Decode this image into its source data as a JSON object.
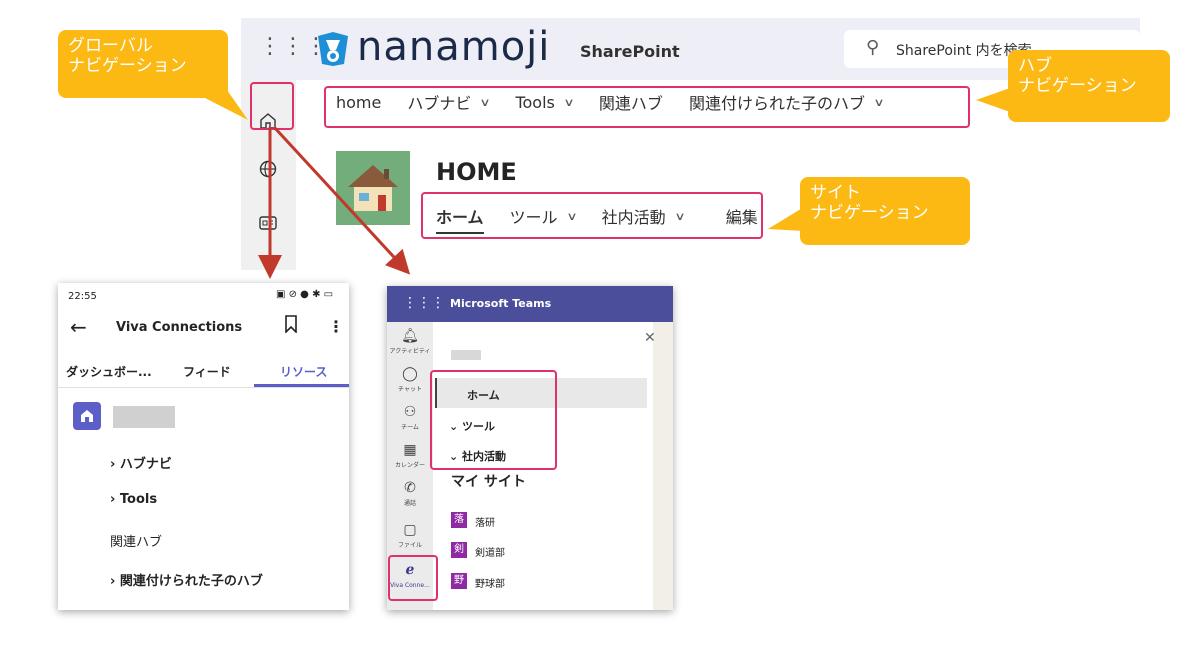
{
  "sharepoint": {
    "waffle": "⋮⋮⋮",
    "logo_text": "nanamoji",
    "product": "SharePoint",
    "search_placeholder": "SharePoint 内を検索",
    "hub_nav": [
      "home",
      "ハブナビ",
      "Tools",
      "関連ハブ",
      "関連付けられた子のハブ"
    ],
    "hub_nav_has_chevron": [
      false,
      true,
      true,
      false,
      true
    ],
    "site_title": "HOME",
    "site_nav": [
      "ホーム",
      "ツール",
      "社内活動",
      "編集"
    ],
    "site_nav_has_chevron": [
      false,
      true,
      true,
      false
    ]
  },
  "callouts": {
    "global": "グローバル\nナビゲーション",
    "hub": "ハブ\nナビゲーション",
    "site": "サイト\nナビゲーション"
  },
  "phone": {
    "time": "22:55",
    "title": "Viva Connections",
    "tabs": [
      "ダッシュボー...",
      "フィード",
      "リソース"
    ],
    "active_tab": "リソース",
    "items": [
      "ハブナビ",
      "Tools",
      "関連ハブ",
      "関連付けられた子のハブ"
    ],
    "items_have_chevron": [
      true,
      true,
      false,
      true
    ]
  },
  "teams": {
    "app_name": "Microsoft Teams",
    "rail": [
      "アクティビティ",
      "チャット",
      "チーム",
      "カレンダー",
      "通話",
      "ファイル",
      "Viva Conne..."
    ],
    "nav_items": [
      "ホーム",
      "ツール",
      "社内活動"
    ],
    "my_sites_heading": "マイ サイト",
    "sites": [
      {
        "badge": "落",
        "name": "落研"
      },
      {
        "badge": "剣",
        "name": "剣道部"
      },
      {
        "badge": "野",
        "name": "野球部"
      }
    ]
  },
  "colors": {
    "accent": "#5b5fc7",
    "callout": "#fcb913",
    "highlight": "#e0316e",
    "arrow": "#c0392b",
    "teams_header": "#4b4e9b"
  }
}
